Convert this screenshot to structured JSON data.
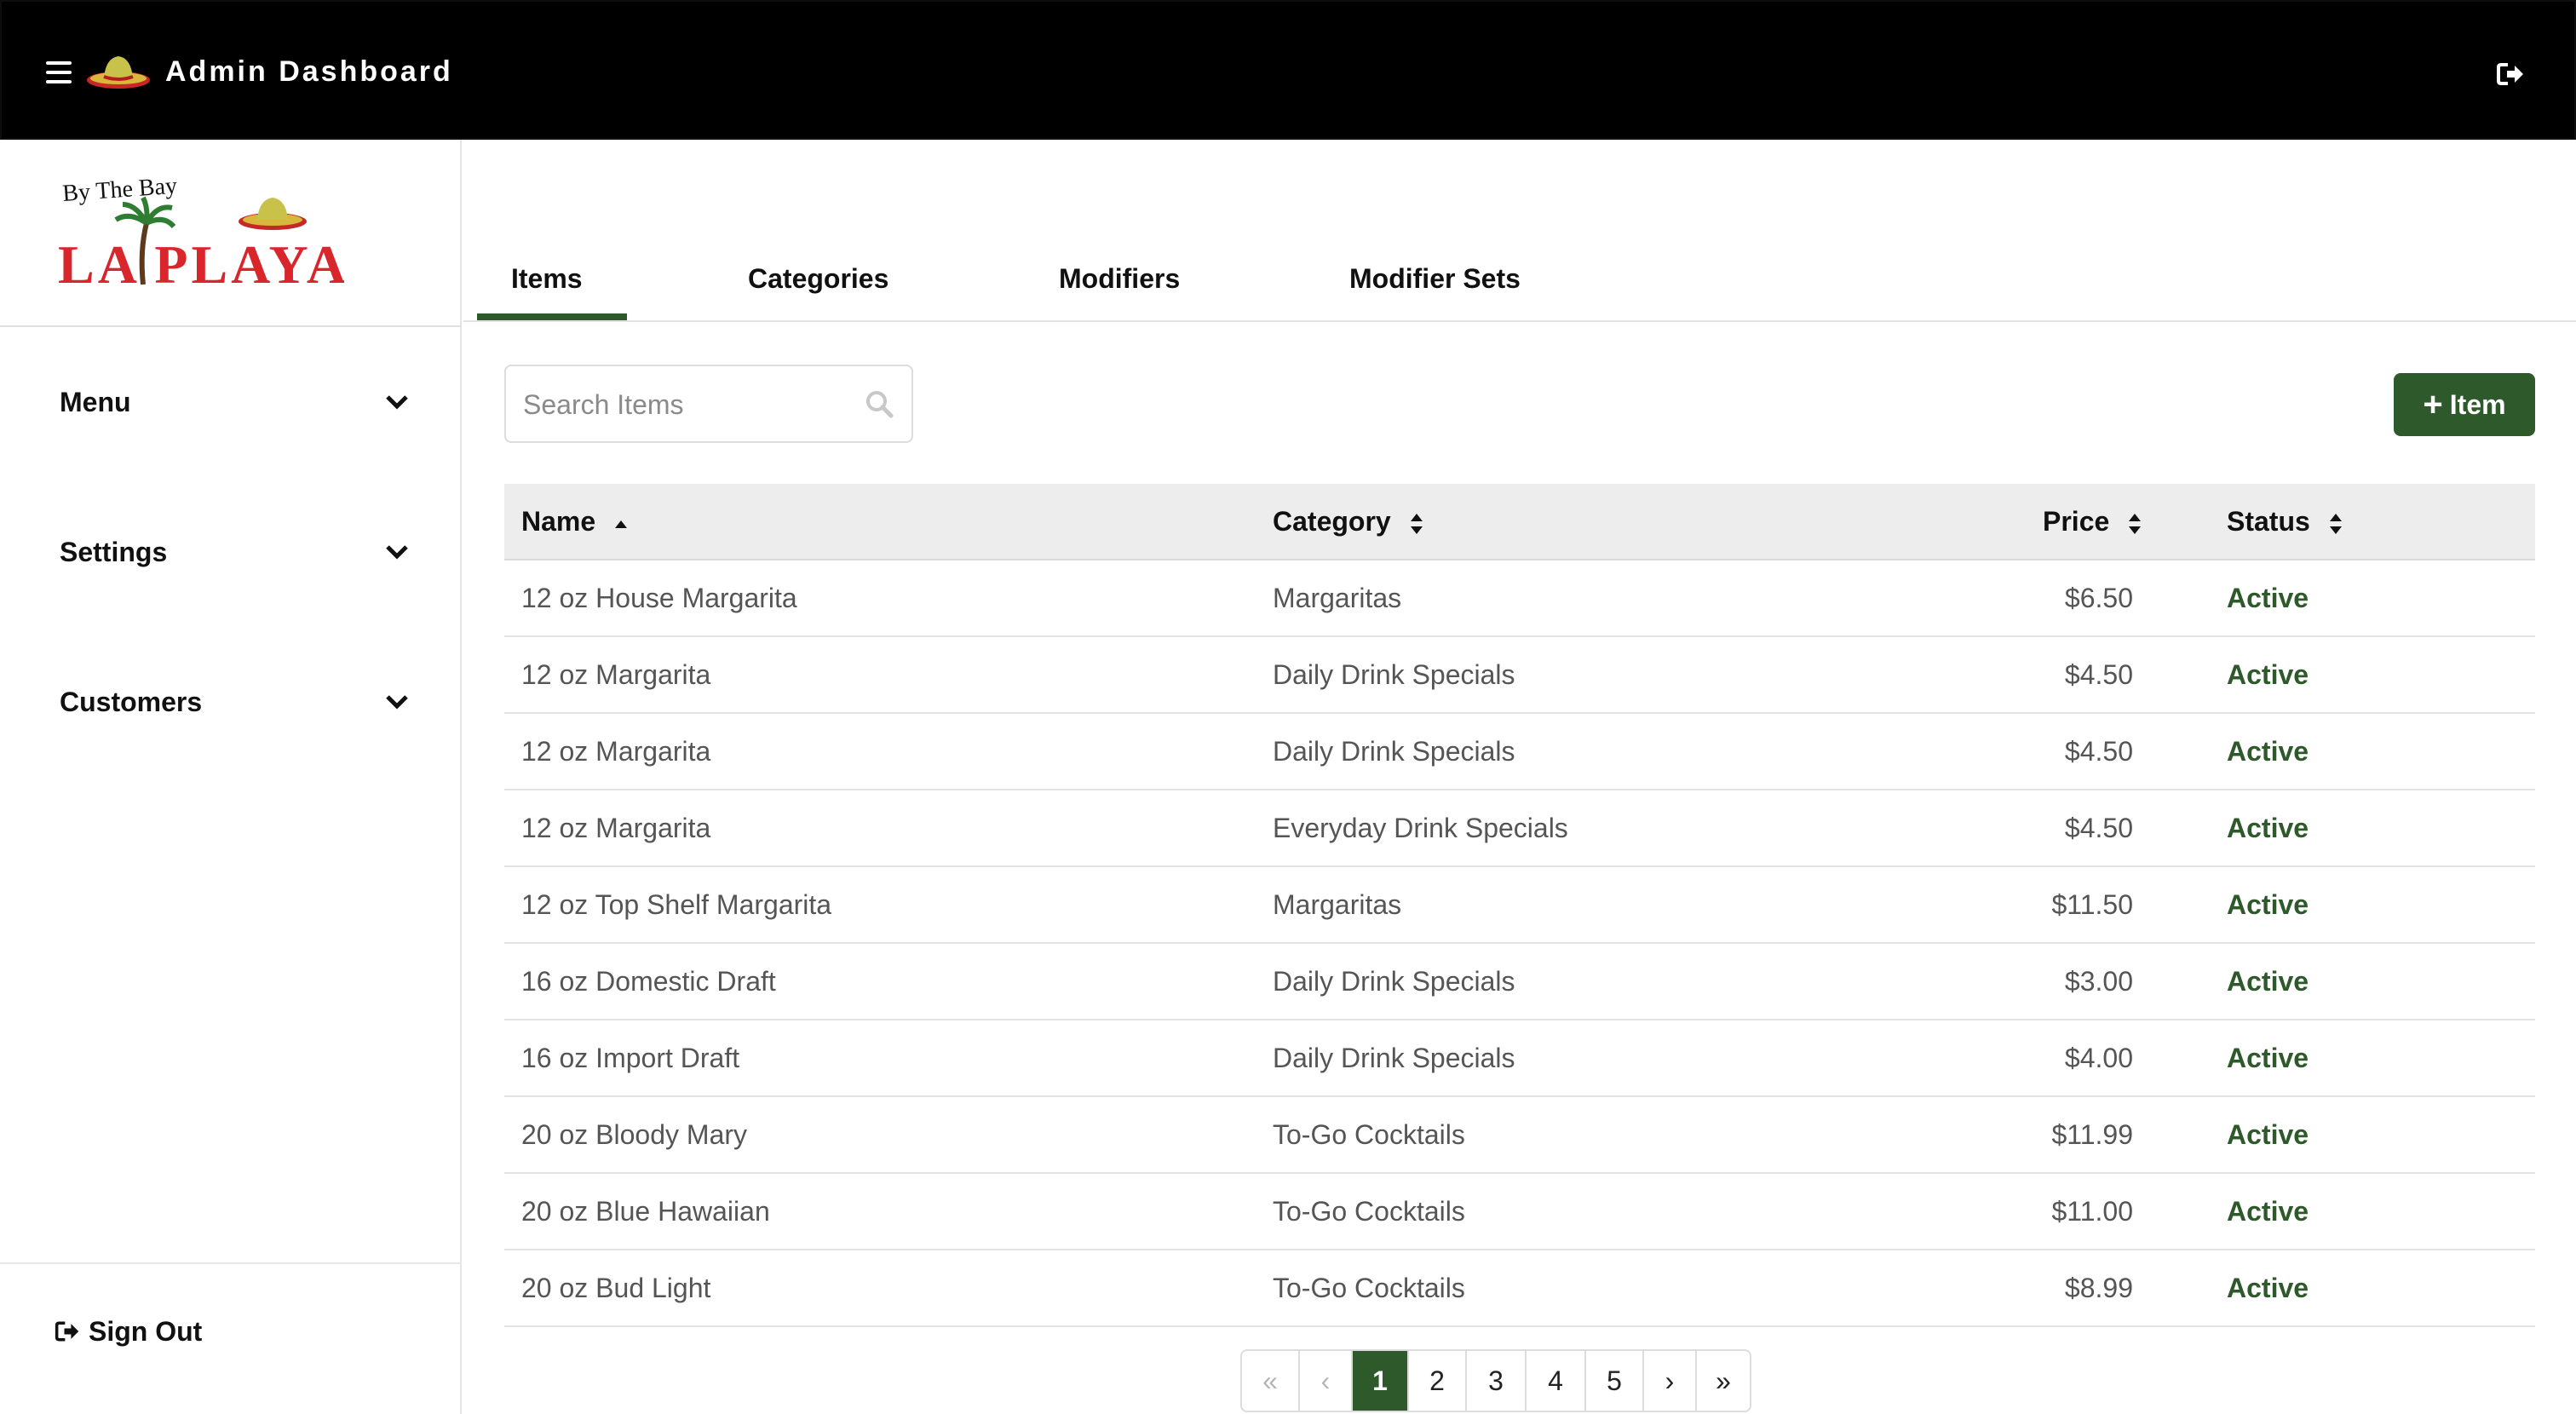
{
  "header": {
    "title": "Admin Dashboard"
  },
  "brand": {
    "logo_top": "By The Bay",
    "logo_main": "LA PLAYA"
  },
  "sidebar": {
    "items": [
      {
        "label": "Menu"
      },
      {
        "label": "Settings"
      },
      {
        "label": "Customers"
      }
    ],
    "signout_label": "Sign Out"
  },
  "tabs": [
    {
      "label": "Items",
      "active": true
    },
    {
      "label": "Categories",
      "active": false
    },
    {
      "label": "Modifiers",
      "active": false
    },
    {
      "label": "Modifier Sets",
      "active": false
    }
  ],
  "search": {
    "placeholder": "Search Items",
    "value": ""
  },
  "add_button": {
    "label": "Item"
  },
  "table": {
    "columns": [
      "Name",
      "Category",
      "Price",
      "Status"
    ],
    "rows": [
      {
        "name": "12 oz House Margarita",
        "category": "Margaritas",
        "price": "$6.50",
        "status": "Active"
      },
      {
        "name": "12 oz Margarita",
        "category": "Daily Drink Specials",
        "price": "$4.50",
        "status": "Active"
      },
      {
        "name": "12 oz Margarita",
        "category": "Daily Drink Specials",
        "price": "$4.50",
        "status": "Active"
      },
      {
        "name": "12 oz Margarita",
        "category": "Everyday Drink Specials",
        "price": "$4.50",
        "status": "Active"
      },
      {
        "name": "12 oz Top Shelf Margarita",
        "category": "Margaritas",
        "price": "$11.50",
        "status": "Active"
      },
      {
        "name": "16 oz Domestic Draft",
        "category": "Daily Drink Specials",
        "price": "$3.00",
        "status": "Active"
      },
      {
        "name": "16 oz Import Draft",
        "category": "Daily Drink Specials",
        "price": "$4.00",
        "status": "Active"
      },
      {
        "name": "20 oz Bloody Mary",
        "category": "To-Go Cocktails",
        "price": "$11.99",
        "status": "Active"
      },
      {
        "name": "20 oz Blue Hawaiian",
        "category": "To-Go Cocktails",
        "price": "$11.00",
        "status": "Active"
      },
      {
        "name": "20 oz Bud Light",
        "category": "To-Go Cocktails",
        "price": "$8.99",
        "status": "Active"
      }
    ]
  },
  "pagination": {
    "first": "«",
    "prev": "‹",
    "pages": [
      "1",
      "2",
      "3",
      "4",
      "5"
    ],
    "current": "1",
    "next": "›",
    "last": "»"
  },
  "colors": {
    "accent": "#2e5a2b",
    "header_bg": "#000000",
    "table_header_bg": "#ededed",
    "logo_red": "#d8262c"
  },
  "icons": {
    "menu": "hamburger-icon",
    "brand": "sombrero-icon",
    "logout": "logout-icon",
    "search": "search-icon",
    "expand": "chevron-down-icon",
    "sort_asc": "sort-asc-icon",
    "sort_both": "sort-icon",
    "add": "plus-icon"
  }
}
